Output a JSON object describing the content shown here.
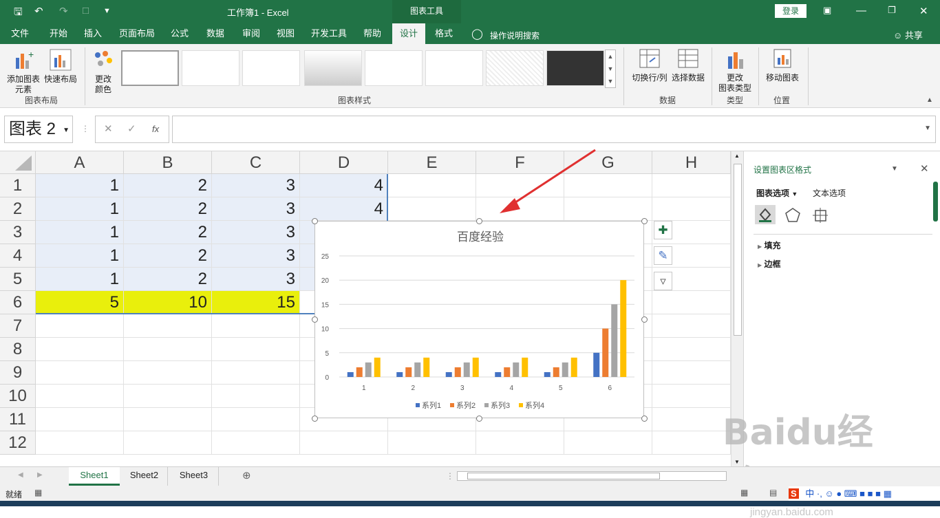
{
  "titlebar": {
    "title": "工作簿1  -  Excel",
    "context_title": "图表工具",
    "login_label": "登录"
  },
  "tabs": [
    "文件",
    "开始",
    "插入",
    "页面布局",
    "公式",
    "数据",
    "审阅",
    "视图",
    "开发工具",
    "帮助",
    "设计",
    "格式"
  ],
  "active_tab": "设计",
  "tell_me": "操作说明搜索",
  "share_label": "共享",
  "ribbon": {
    "add_element": "添加图表\n元素",
    "quick_layout": "快速布局",
    "change_colors": "更改\n颜色",
    "group_layout": "图表布局",
    "group_styles": "图表样式",
    "switch_row_col": "切换行/列",
    "select_data": "选择数据",
    "group_data": "数据",
    "change_type": "更改\n图表类型",
    "group_type": "类型",
    "move_chart": "移动图表",
    "group_location": "位置"
  },
  "formula": {
    "name_box": "图表 2",
    "fx": "fx",
    "value": ""
  },
  "columns": [
    "A",
    "B",
    "C",
    "D",
    "E",
    "F",
    "G",
    "H"
  ],
  "rows": [
    {
      "n": "1",
      "vals": [
        "1",
        "2",
        "3",
        "4"
      ]
    },
    {
      "n": "2",
      "vals": [
        "1",
        "2",
        "3",
        "4"
      ]
    },
    {
      "n": "3",
      "vals": [
        "1",
        "2",
        "3",
        ""
      ]
    },
    {
      "n": "4",
      "vals": [
        "1",
        "2",
        "3",
        ""
      ]
    },
    {
      "n": "5",
      "vals": [
        "1",
        "2",
        "3",
        ""
      ]
    },
    {
      "n": "6",
      "vals": [
        "5",
        "10",
        "15",
        ""
      ]
    },
    {
      "n": "7",
      "vals": [
        "",
        "",
        "",
        ""
      ]
    },
    {
      "n": "8",
      "vals": [
        "",
        "",
        "",
        ""
      ]
    },
    {
      "n": "9",
      "vals": [
        "",
        "",
        "",
        ""
      ]
    },
    {
      "n": "10",
      "vals": [
        "",
        "",
        "",
        ""
      ]
    },
    {
      "n": "11",
      "vals": [
        "",
        "",
        "",
        ""
      ]
    },
    {
      "n": "12",
      "vals": [
        "",
        "",
        "",
        ""
      ]
    }
  ],
  "chart_data": {
    "type": "bar",
    "title": "百度经验",
    "categories": [
      "1",
      "2",
      "3",
      "4",
      "5",
      "6"
    ],
    "ylim": [
      0,
      25
    ],
    "yticks": [
      "0",
      "5",
      "10",
      "15",
      "20",
      "25"
    ],
    "grid": true,
    "legend": "bottom",
    "series": [
      {
        "name": "系列1",
        "color": "#4472c4",
        "values": [
          1,
          1,
          1,
          1,
          1,
          5
        ]
      },
      {
        "name": "系列2",
        "color": "#ed7d31",
        "values": [
          2,
          2,
          2,
          2,
          2,
          10
        ]
      },
      {
        "name": "系列3",
        "color": "#a5a5a5",
        "values": [
          3,
          3,
          3,
          3,
          3,
          15
        ]
      },
      {
        "name": "系列4",
        "color": "#ffc000",
        "values": [
          4,
          4,
          4,
          4,
          4,
          20
        ]
      }
    ]
  },
  "panel": {
    "title": "设置图表区格式",
    "tab_chart": "图表选项",
    "tab_text": "文本选项",
    "fill": "填充",
    "border": "边框"
  },
  "sheets": [
    "Sheet1",
    "Sheet2",
    "Sheet3"
  ],
  "active_sheet": "Sheet1",
  "status": {
    "ready": "就绪"
  },
  "watermark": {
    "brand": "Baidu经验",
    "url": "jingyan.baidu.com"
  },
  "colors": {
    "excel_green": "#217346",
    "highlight_yellow": "#e9ef0c",
    "selection": "#e8eef8",
    "arrow": "#e03030"
  }
}
